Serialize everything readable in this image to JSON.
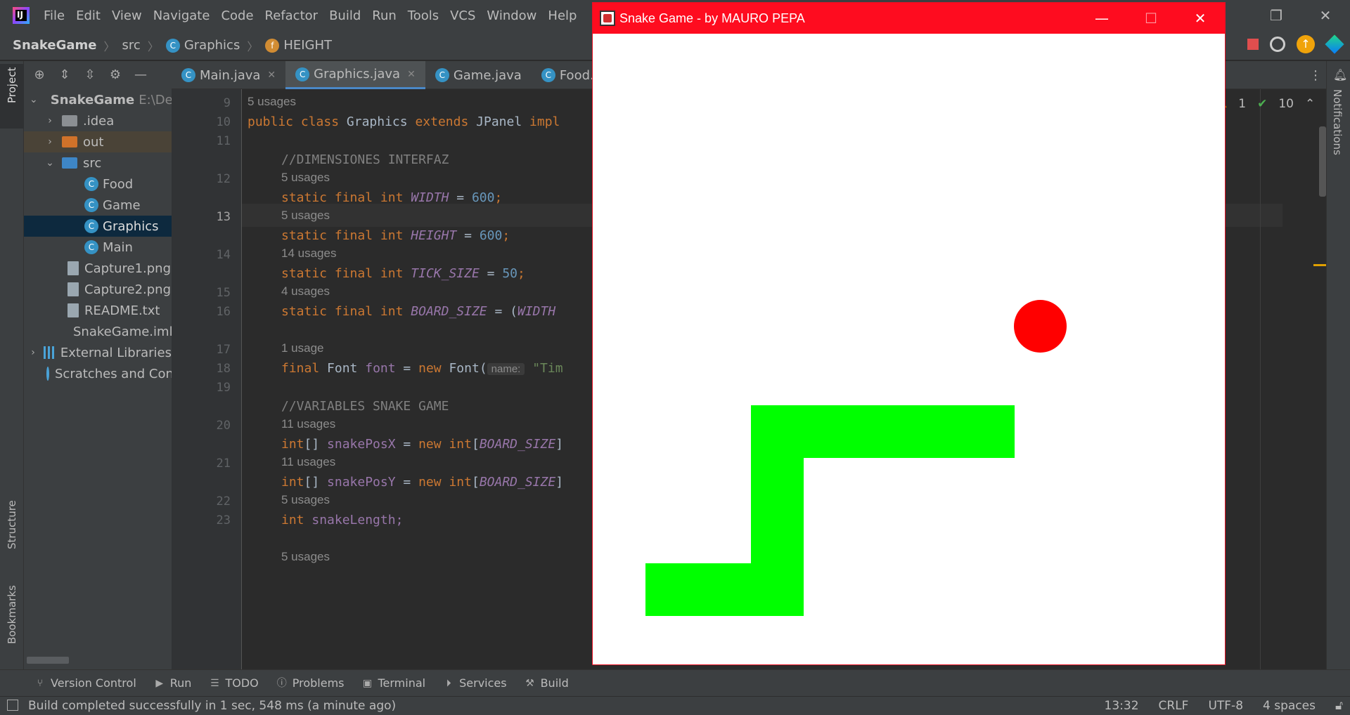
{
  "menubar": {
    "items": [
      "File",
      "Edit",
      "View",
      "Navigate",
      "Code",
      "Refactor",
      "Build",
      "Run",
      "Tools",
      "VCS",
      "Window",
      "Help"
    ],
    "window_controls": [
      "restore-icon",
      "close-icon"
    ]
  },
  "breadcrumb": {
    "project": "SnakeGame",
    "folder": "src",
    "class": "Graphics",
    "field": "HEIGHT"
  },
  "left_stripe": {
    "project": "Project",
    "structure": "Structure",
    "bookmarks": "Bookmarks"
  },
  "project_tree": {
    "root": "SnakeGame",
    "root_path": "E:\\De",
    "items": [
      {
        "label": ".idea"
      },
      {
        "label": "out"
      },
      {
        "label": "src"
      },
      {
        "label": "Food"
      },
      {
        "label": "Game"
      },
      {
        "label": "Graphics"
      },
      {
        "label": "Main"
      },
      {
        "label": "Capture1.png"
      },
      {
        "label": "Capture2.png"
      },
      {
        "label": "README.txt"
      },
      {
        "label": "SnakeGame.iml"
      },
      {
        "label": "External Libraries"
      },
      {
        "label": "Scratches and Cons"
      }
    ]
  },
  "editor_tabs": [
    {
      "label": "Main.java"
    },
    {
      "label": "Graphics.java"
    },
    {
      "label": "Game.java"
    },
    {
      "label": "Food.java"
    }
  ],
  "inspections": {
    "warnings": "1",
    "checks": "10"
  },
  "code": {
    "usages": [
      "5 usages",
      "5 usages",
      "5 usages",
      "14 usages",
      "4 usages",
      "1 usage",
      "11 usages",
      "11 usages",
      "5 usages",
      "5 usages"
    ],
    "line_numbers": [
      "9",
      "10",
      "11",
      "12",
      "13",
      "14",
      "15",
      "16",
      "17",
      "18",
      "19",
      "20",
      "21",
      "22",
      "23"
    ],
    "l9_kw1": "public",
    "l9_kw2": "class",
    "l9_name": "Graphics",
    "l9_kw3": "extends",
    "l9_sup": "JPanel",
    "l9_kw4": "impl",
    "l11_comment": "//DIMENSIONES INTERFAZ",
    "static": "static",
    "final": "final",
    "int": "int",
    "new": "new",
    "width_name": "WIDTH",
    "width_val": "600",
    "height_name": "HEIGHT",
    "height_val": "600",
    "tick_name": "TICK_SIZE",
    "tick_val": "50",
    "board_name": "BOARD_SIZE",
    "board_rest": "= (",
    "board_width": "WIDTH",
    "l17_type": "Font",
    "l17_var": "font",
    "l17_ctor": "Font(",
    "l17_hint": "name:",
    "l17_str": "\"Tim",
    "l19_comment": "//VARIABLES SNAKE GAME",
    "l20_var": "snakePosX",
    "l21_var": "snakePosY",
    "board_ref": "BOARD_SIZE",
    "l22_var": "snakeLength;"
  },
  "right_stripe": {
    "notifications": "Notifications"
  },
  "tool_windows": [
    {
      "label": "Version Control"
    },
    {
      "label": "Run"
    },
    {
      "label": "TODO"
    },
    {
      "label": "Problems"
    },
    {
      "label": "Terminal"
    },
    {
      "label": "Services"
    },
    {
      "label": "Build"
    }
  ],
  "status": {
    "message": "Build completed successfully in 1 sec, 548 ms (a minute ago)",
    "position": "13:32",
    "line_sep": "CRLF",
    "encoding": "UTF-8",
    "indent": "4 spaces"
  },
  "game": {
    "title": "Snake Game - by MAURO PEPA",
    "title_color": "#fe0c1f",
    "snake_color": "#00ff00",
    "food_color": "#ff0000"
  }
}
